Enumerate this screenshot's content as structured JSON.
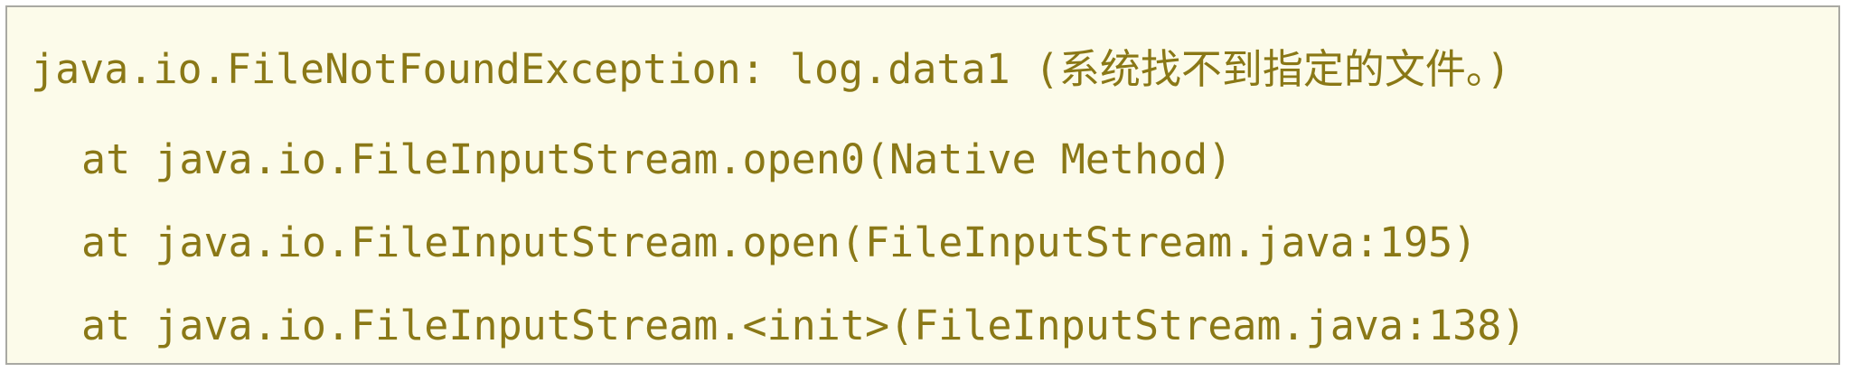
{
  "stack_trace": {
    "lines": [
      "java.io.FileNotFoundException: log.data1 (系统找不到指定的文件。)",
      "at java.io.FileInputStream.open0(Native Method)",
      "at java.io.FileInputStream.open(FileInputStream.java:195)",
      "at java.io.FileInputStream.<init>(FileInputStream.java:138)"
    ]
  },
  "colors": {
    "text": "#8a7816",
    "background": "#fcfbea",
    "border": "#a9a9a3"
  }
}
